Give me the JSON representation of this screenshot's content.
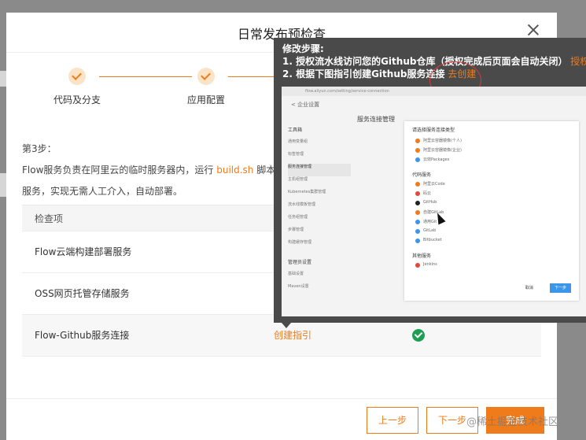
{
  "dialog": {
    "title": "日常发布预检查"
  },
  "steps": [
    {
      "label": "代码及分支"
    },
    {
      "label": "应用配置"
    }
  ],
  "description": {
    "line1_prefix": "第3步：",
    "line2_text": "Flow服务负责在阿里云的临时服务器内，运行",
    "line2_highlight": "build.sh",
    "line2_suffix": "脚本",
    "line3": "服务，实现无需人工介入，自动部署。"
  },
  "table": {
    "header": "检查项",
    "rows": [
      {
        "name": "Flow云端构建部署服务",
        "action": "",
        "status": ""
      },
      {
        "name": "OSS网页托管存储服务",
        "action": "",
        "status": ""
      },
      {
        "name": "Flow-Github服务连接",
        "action": "创建指引",
        "status": "ok"
      }
    ]
  },
  "footer": {
    "prev_label": "上一步",
    "next_label": "下一步",
    "finish_label": "完成",
    "watermark": "@稀土掘金技术社区"
  },
  "popup": {
    "heading": "修改步骤:",
    "step1_text": "1. 授权流水线访问您的Github仓库（授权完成后页面会自动关闭）",
    "step1_link": "授权链",
    "step2_text": "2. 根据下图指引创建Github服务连接",
    "step2_link": "去创建"
  },
  "screenshot": {
    "url": "flow.aliyun.com/setting/service-connection",
    "breadcrumb": "< 企业设置",
    "sidebar_group1": "工具箱",
    "sidebar_items": [
      "通用变量组",
      "标签管理",
      "服务连接管理",
      "主机组管理",
      "Kubernetes集群管理",
      "流水线模板管理",
      "任务组管理",
      "步骤管理",
      "构建缓存管理"
    ],
    "sidebar_group2": "管理员设置",
    "sidebar_items2": [
      "基础设置",
      "Maven设置"
    ],
    "main_title": "服务连接管理",
    "card_title": "请选择服务连接类型",
    "card_options_top": [
      "阿里云容器镜像(个人)",
      "阿里云容器镜像(企业)",
      "云效Packages"
    ],
    "code_section": "代码服务",
    "code_options": [
      "阿里云Code",
      "码云",
      "GitHub",
      "自建GitLab",
      "通用Git",
      "GitLab",
      "Bitbucket"
    ],
    "other_section": "其他服务",
    "other_option": "Jenkins",
    "cancel_label": "取消",
    "next_label": "下一步"
  },
  "colors": {
    "accent": "#f07b1a",
    "success": "#1e9e52",
    "popup_bg": "#4a4a4a"
  }
}
